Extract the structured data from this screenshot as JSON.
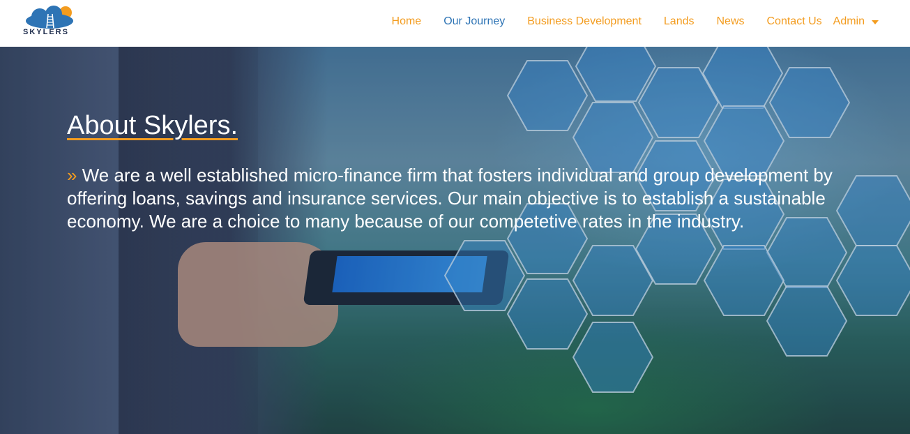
{
  "brand": {
    "name": "SKYLERS"
  },
  "nav": {
    "items": [
      {
        "label": "Home"
      },
      {
        "label": "Our Journey"
      },
      {
        "label": "Business Development"
      },
      {
        "label": "Lands"
      },
      {
        "label": "News"
      },
      {
        "label": "Contact Us"
      }
    ],
    "admin_label": "Admin"
  },
  "hero": {
    "title": "About Skylers.",
    "bullet": "»",
    "text": "We are a well established micro-finance firm that fosters individual and group development by offering loans, savings and insurance services. Our main objective is to establish a sustainable economy. We are a choice to many because of our competetive rates in the industry."
  },
  "colors": {
    "accent": "#f39c1f",
    "active_link": "#2e74b5",
    "brand_dark": "#1b2a4a",
    "cloud": "#2e74b5"
  }
}
